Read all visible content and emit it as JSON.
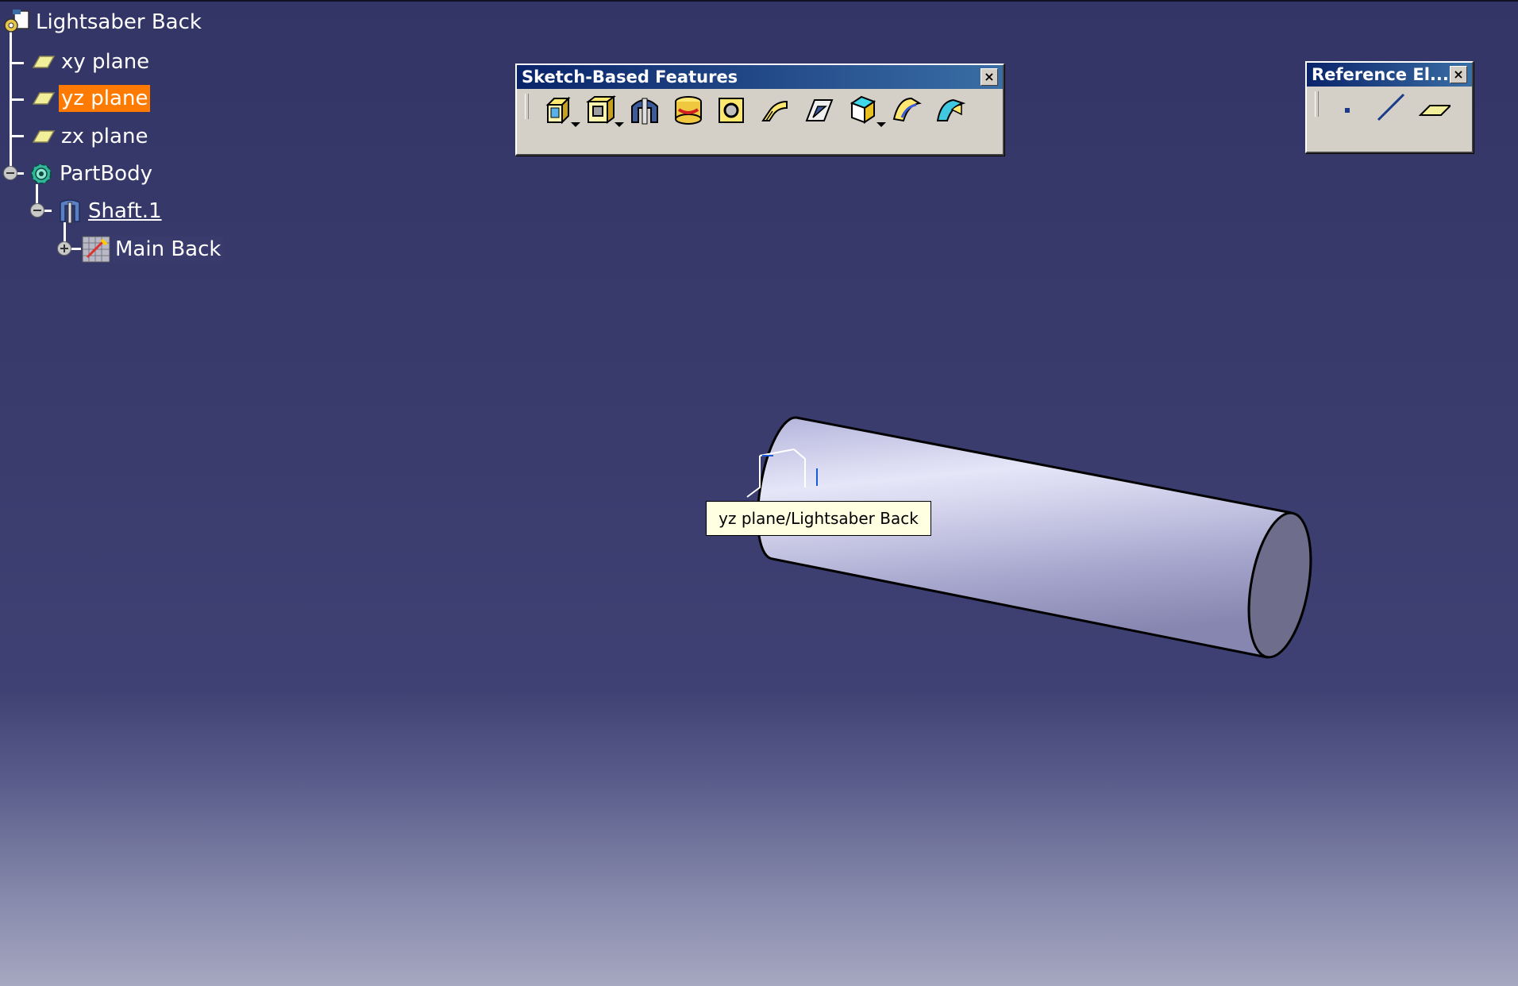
{
  "tree": {
    "root": "Lightsaber Back",
    "items": [
      {
        "label": "xy plane"
      },
      {
        "label": "yz plane",
        "selected": true
      },
      {
        "label": "zx plane"
      },
      {
        "label": "PartBody"
      },
      {
        "label": "Shaft.1"
      },
      {
        "label": "Main Back"
      }
    ]
  },
  "toolbars": {
    "sketch_based": {
      "title": "Sketch-Based Features",
      "close": "×",
      "tools": [
        "pad-icon",
        "pocket-icon",
        "shaft-icon",
        "groove-icon",
        "hole-icon",
        "rib-icon",
        "slot-icon",
        "stiffener-icon",
        "multi-section-solid-icon",
        "removed-multi-section-solid-icon"
      ]
    },
    "reference": {
      "title": "Reference El...",
      "close": "×",
      "tools": [
        "point-icon",
        "line-icon",
        "plane-icon"
      ]
    }
  },
  "tooltip": {
    "text": "yz plane/Lightsaber Back"
  },
  "colors": {
    "selection": "#ff7a00",
    "background_top": "#333566",
    "background_bottom": "#a5a8c0"
  }
}
